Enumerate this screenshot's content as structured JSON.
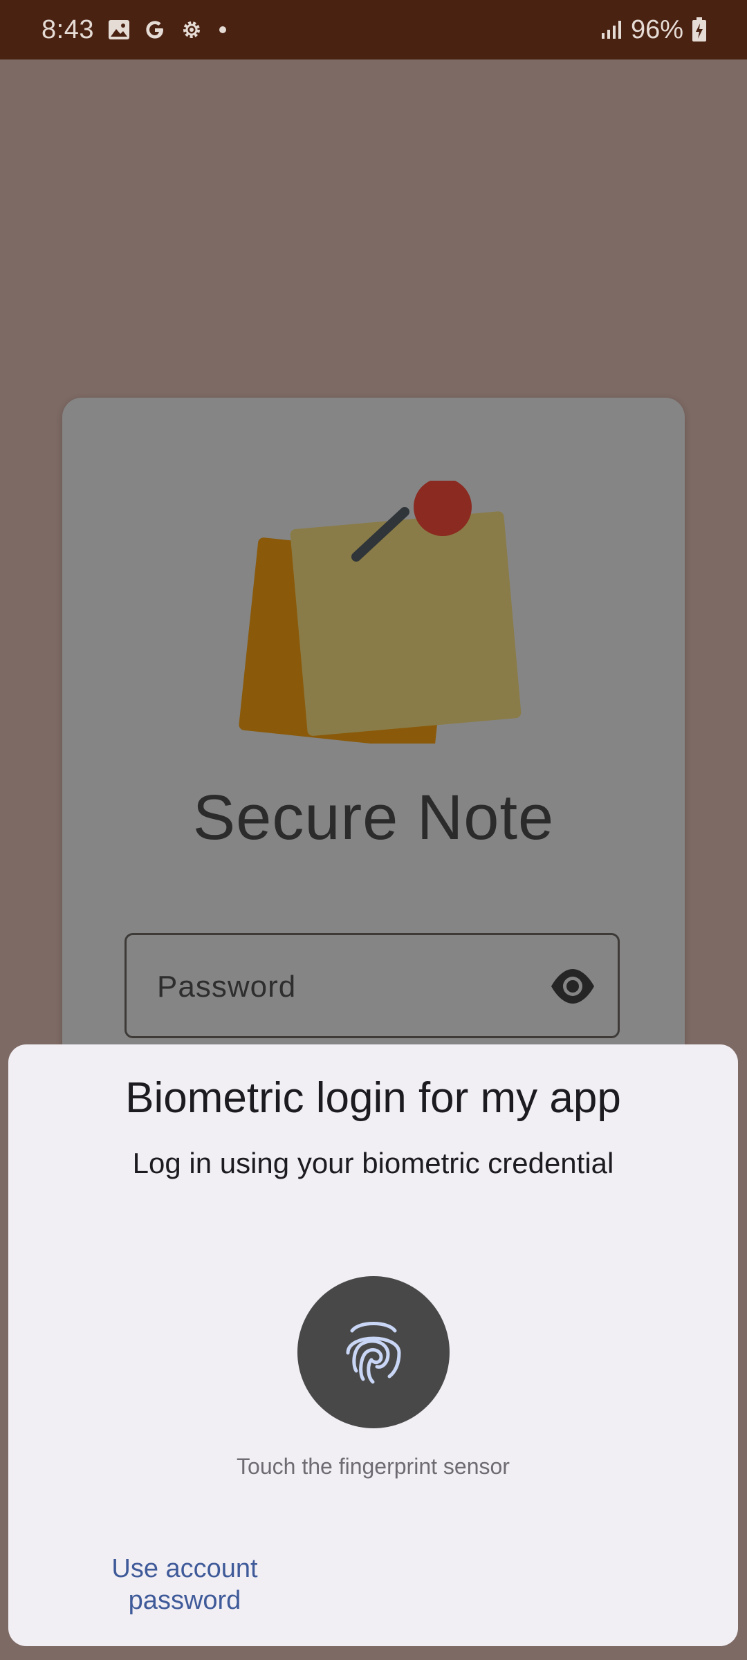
{
  "status_bar": {
    "time": "8:43",
    "battery_percent": "96%",
    "icons": [
      "gallery-icon",
      "google-icon",
      "settings-icon",
      "notification-dot-icon",
      "signal-icon",
      "battery-charging-icon"
    ]
  },
  "login_card": {
    "app_title": "Secure Note",
    "password_placeholder": "Password",
    "logo_icon": "pinned-notes-logo",
    "visibility_icon": "eye-icon"
  },
  "biometric_prompt": {
    "title": "Biometric login for my app",
    "subtitle": "Log in using your biometric credential",
    "hint": "Touch the fingerprint sensor",
    "negative_button_line1": "Use account",
    "negative_button_line2": "password"
  },
  "colors": {
    "status_bar": "#4a2212",
    "scrim_background": "#7e6a64",
    "sheet_background": "#f1eef4",
    "fingerprint_circle": "#484848",
    "fingerprint_lines": "#c9d6f5",
    "link_text": "#3f5a99"
  }
}
